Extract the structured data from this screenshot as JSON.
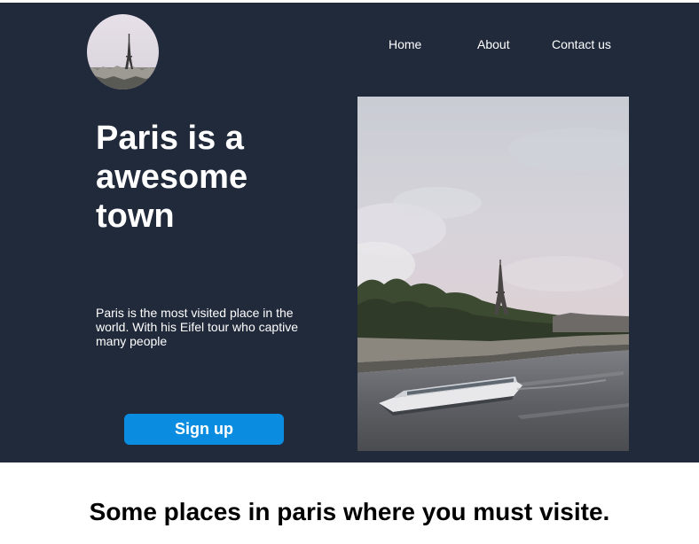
{
  "nav": {
    "items": [
      {
        "label": "Home"
      },
      {
        "label": "About"
      },
      {
        "label": "Contact us"
      }
    ]
  },
  "hero": {
    "headline": "Paris is a awesome town",
    "description": "Paris is the most visited place in the world. With his Eifel tour who captive many people",
    "cta_label": "Sign up"
  },
  "section": {
    "title": "Some places in paris where you must visite."
  },
  "colors": {
    "hero_background": "#212a3b",
    "button": "#0a8ce0",
    "text_light": "#ffffff"
  },
  "icons": {
    "logo": "eiffel-tower-round-photo",
    "hero_image": "seine-river-boat-eiffel-tower-photo"
  }
}
